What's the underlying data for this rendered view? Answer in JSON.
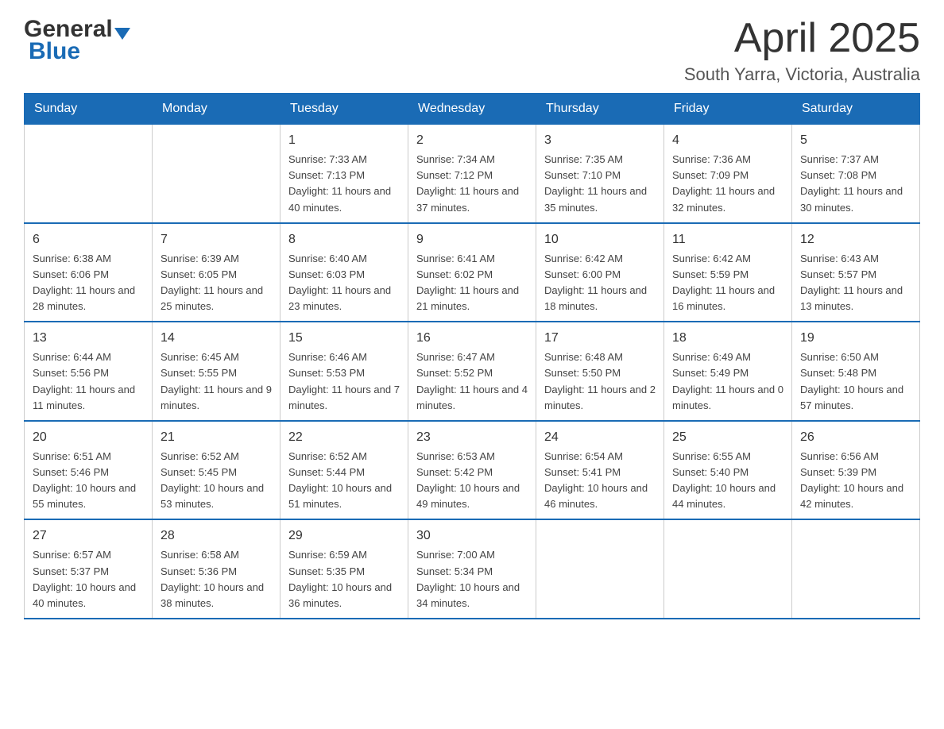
{
  "header": {
    "logo_general": "General",
    "logo_blue": "Blue",
    "month_title": "April 2025",
    "location": "South Yarra, Victoria, Australia"
  },
  "weekdays": [
    "Sunday",
    "Monday",
    "Tuesday",
    "Wednesday",
    "Thursday",
    "Friday",
    "Saturday"
  ],
  "weeks": [
    [
      {
        "day": "",
        "sunrise": "",
        "sunset": "",
        "daylight": ""
      },
      {
        "day": "",
        "sunrise": "",
        "sunset": "",
        "daylight": ""
      },
      {
        "day": "1",
        "sunrise": "Sunrise: 7:33 AM",
        "sunset": "Sunset: 7:13 PM",
        "daylight": "Daylight: 11 hours and 40 minutes."
      },
      {
        "day": "2",
        "sunrise": "Sunrise: 7:34 AM",
        "sunset": "Sunset: 7:12 PM",
        "daylight": "Daylight: 11 hours and 37 minutes."
      },
      {
        "day": "3",
        "sunrise": "Sunrise: 7:35 AM",
        "sunset": "Sunset: 7:10 PM",
        "daylight": "Daylight: 11 hours and 35 minutes."
      },
      {
        "day": "4",
        "sunrise": "Sunrise: 7:36 AM",
        "sunset": "Sunset: 7:09 PM",
        "daylight": "Daylight: 11 hours and 32 minutes."
      },
      {
        "day": "5",
        "sunrise": "Sunrise: 7:37 AM",
        "sunset": "Sunset: 7:08 PM",
        "daylight": "Daylight: 11 hours and 30 minutes."
      }
    ],
    [
      {
        "day": "6",
        "sunrise": "Sunrise: 6:38 AM",
        "sunset": "Sunset: 6:06 PM",
        "daylight": "Daylight: 11 hours and 28 minutes."
      },
      {
        "day": "7",
        "sunrise": "Sunrise: 6:39 AM",
        "sunset": "Sunset: 6:05 PM",
        "daylight": "Daylight: 11 hours and 25 minutes."
      },
      {
        "day": "8",
        "sunrise": "Sunrise: 6:40 AM",
        "sunset": "Sunset: 6:03 PM",
        "daylight": "Daylight: 11 hours and 23 minutes."
      },
      {
        "day": "9",
        "sunrise": "Sunrise: 6:41 AM",
        "sunset": "Sunset: 6:02 PM",
        "daylight": "Daylight: 11 hours and 21 minutes."
      },
      {
        "day": "10",
        "sunrise": "Sunrise: 6:42 AM",
        "sunset": "Sunset: 6:00 PM",
        "daylight": "Daylight: 11 hours and 18 minutes."
      },
      {
        "day": "11",
        "sunrise": "Sunrise: 6:42 AM",
        "sunset": "Sunset: 5:59 PM",
        "daylight": "Daylight: 11 hours and 16 minutes."
      },
      {
        "day": "12",
        "sunrise": "Sunrise: 6:43 AM",
        "sunset": "Sunset: 5:57 PM",
        "daylight": "Daylight: 11 hours and 13 minutes."
      }
    ],
    [
      {
        "day": "13",
        "sunrise": "Sunrise: 6:44 AM",
        "sunset": "Sunset: 5:56 PM",
        "daylight": "Daylight: 11 hours and 11 minutes."
      },
      {
        "day": "14",
        "sunrise": "Sunrise: 6:45 AM",
        "sunset": "Sunset: 5:55 PM",
        "daylight": "Daylight: 11 hours and 9 minutes."
      },
      {
        "day": "15",
        "sunrise": "Sunrise: 6:46 AM",
        "sunset": "Sunset: 5:53 PM",
        "daylight": "Daylight: 11 hours and 7 minutes."
      },
      {
        "day": "16",
        "sunrise": "Sunrise: 6:47 AM",
        "sunset": "Sunset: 5:52 PM",
        "daylight": "Daylight: 11 hours and 4 minutes."
      },
      {
        "day": "17",
        "sunrise": "Sunrise: 6:48 AM",
        "sunset": "Sunset: 5:50 PM",
        "daylight": "Daylight: 11 hours and 2 minutes."
      },
      {
        "day": "18",
        "sunrise": "Sunrise: 6:49 AM",
        "sunset": "Sunset: 5:49 PM",
        "daylight": "Daylight: 11 hours and 0 minutes."
      },
      {
        "day": "19",
        "sunrise": "Sunrise: 6:50 AM",
        "sunset": "Sunset: 5:48 PM",
        "daylight": "Daylight: 10 hours and 57 minutes."
      }
    ],
    [
      {
        "day": "20",
        "sunrise": "Sunrise: 6:51 AM",
        "sunset": "Sunset: 5:46 PM",
        "daylight": "Daylight: 10 hours and 55 minutes."
      },
      {
        "day": "21",
        "sunrise": "Sunrise: 6:52 AM",
        "sunset": "Sunset: 5:45 PM",
        "daylight": "Daylight: 10 hours and 53 minutes."
      },
      {
        "day": "22",
        "sunrise": "Sunrise: 6:52 AM",
        "sunset": "Sunset: 5:44 PM",
        "daylight": "Daylight: 10 hours and 51 minutes."
      },
      {
        "day": "23",
        "sunrise": "Sunrise: 6:53 AM",
        "sunset": "Sunset: 5:42 PM",
        "daylight": "Daylight: 10 hours and 49 minutes."
      },
      {
        "day": "24",
        "sunrise": "Sunrise: 6:54 AM",
        "sunset": "Sunset: 5:41 PM",
        "daylight": "Daylight: 10 hours and 46 minutes."
      },
      {
        "day": "25",
        "sunrise": "Sunrise: 6:55 AM",
        "sunset": "Sunset: 5:40 PM",
        "daylight": "Daylight: 10 hours and 44 minutes."
      },
      {
        "day": "26",
        "sunrise": "Sunrise: 6:56 AM",
        "sunset": "Sunset: 5:39 PM",
        "daylight": "Daylight: 10 hours and 42 minutes."
      }
    ],
    [
      {
        "day": "27",
        "sunrise": "Sunrise: 6:57 AM",
        "sunset": "Sunset: 5:37 PM",
        "daylight": "Daylight: 10 hours and 40 minutes."
      },
      {
        "day": "28",
        "sunrise": "Sunrise: 6:58 AM",
        "sunset": "Sunset: 5:36 PM",
        "daylight": "Daylight: 10 hours and 38 minutes."
      },
      {
        "day": "29",
        "sunrise": "Sunrise: 6:59 AM",
        "sunset": "Sunset: 5:35 PM",
        "daylight": "Daylight: 10 hours and 36 minutes."
      },
      {
        "day": "30",
        "sunrise": "Sunrise: 7:00 AM",
        "sunset": "Sunset: 5:34 PM",
        "daylight": "Daylight: 10 hours and 34 minutes."
      },
      {
        "day": "",
        "sunrise": "",
        "sunset": "",
        "daylight": ""
      },
      {
        "day": "",
        "sunrise": "",
        "sunset": "",
        "daylight": ""
      },
      {
        "day": "",
        "sunrise": "",
        "sunset": "",
        "daylight": ""
      }
    ]
  ]
}
